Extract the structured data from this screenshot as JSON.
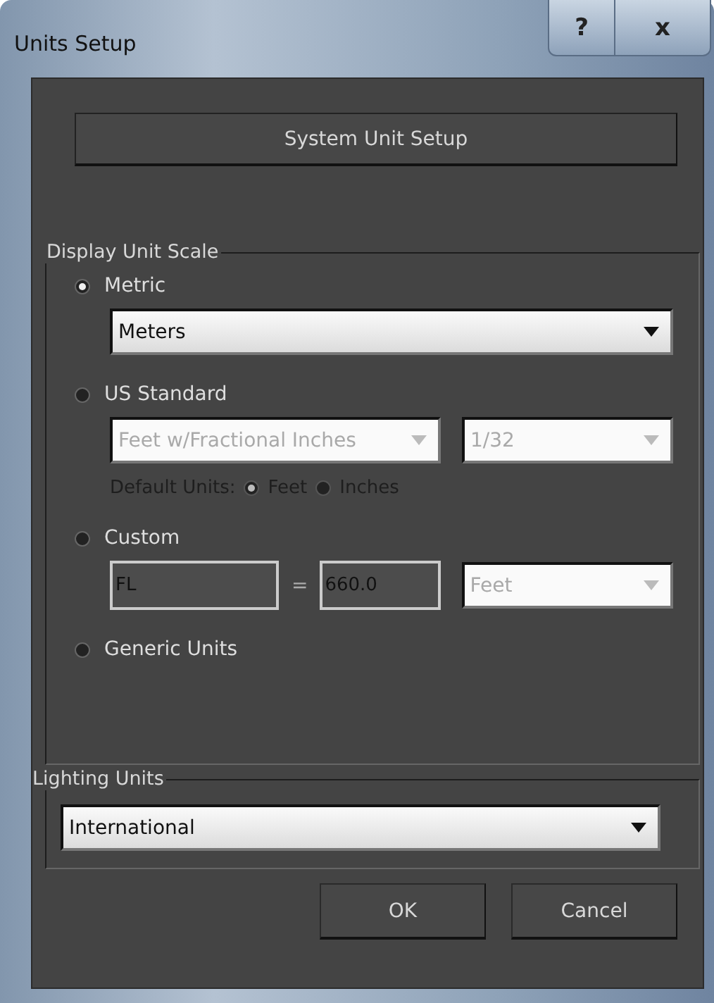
{
  "window": {
    "title": "Units Setup",
    "help_button": "?",
    "close_button": "x"
  },
  "system_unit_setup_button": "System Unit Setup",
  "display_unit_scale": {
    "title": "Display Unit Scale",
    "options": [
      {
        "kind": "metric",
        "label": "Metric",
        "selected": true,
        "dropdown": {
          "value": "Meters",
          "disabled": false
        }
      },
      {
        "kind": "us_standard",
        "label": "US Standard",
        "selected": false,
        "dropdowns": [
          {
            "value": "Feet w/Fractional Inches",
            "disabled": true
          },
          {
            "value": "1/32",
            "disabled": true
          }
        ],
        "default_units_label": "Default Units:",
        "default_units": [
          {
            "label": "Feet",
            "selected": true
          },
          {
            "label": "Inches",
            "selected": false
          }
        ]
      },
      {
        "kind": "custom",
        "label": "Custom",
        "selected": false,
        "name_field": {
          "value": "FL",
          "disabled": true
        },
        "equals": "=",
        "value_field": {
          "value": "660.0",
          "disabled": true
        },
        "unit_dropdown": {
          "value": "Feet",
          "disabled": true
        }
      },
      {
        "kind": "generic",
        "label": "Generic Units",
        "selected": false
      }
    ]
  },
  "lighting_units": {
    "title": "Lighting Units",
    "dropdown": {
      "value": "International",
      "disabled": false
    }
  },
  "buttons": [
    {
      "label": "OK"
    },
    {
      "label": "Cancel"
    }
  ]
}
